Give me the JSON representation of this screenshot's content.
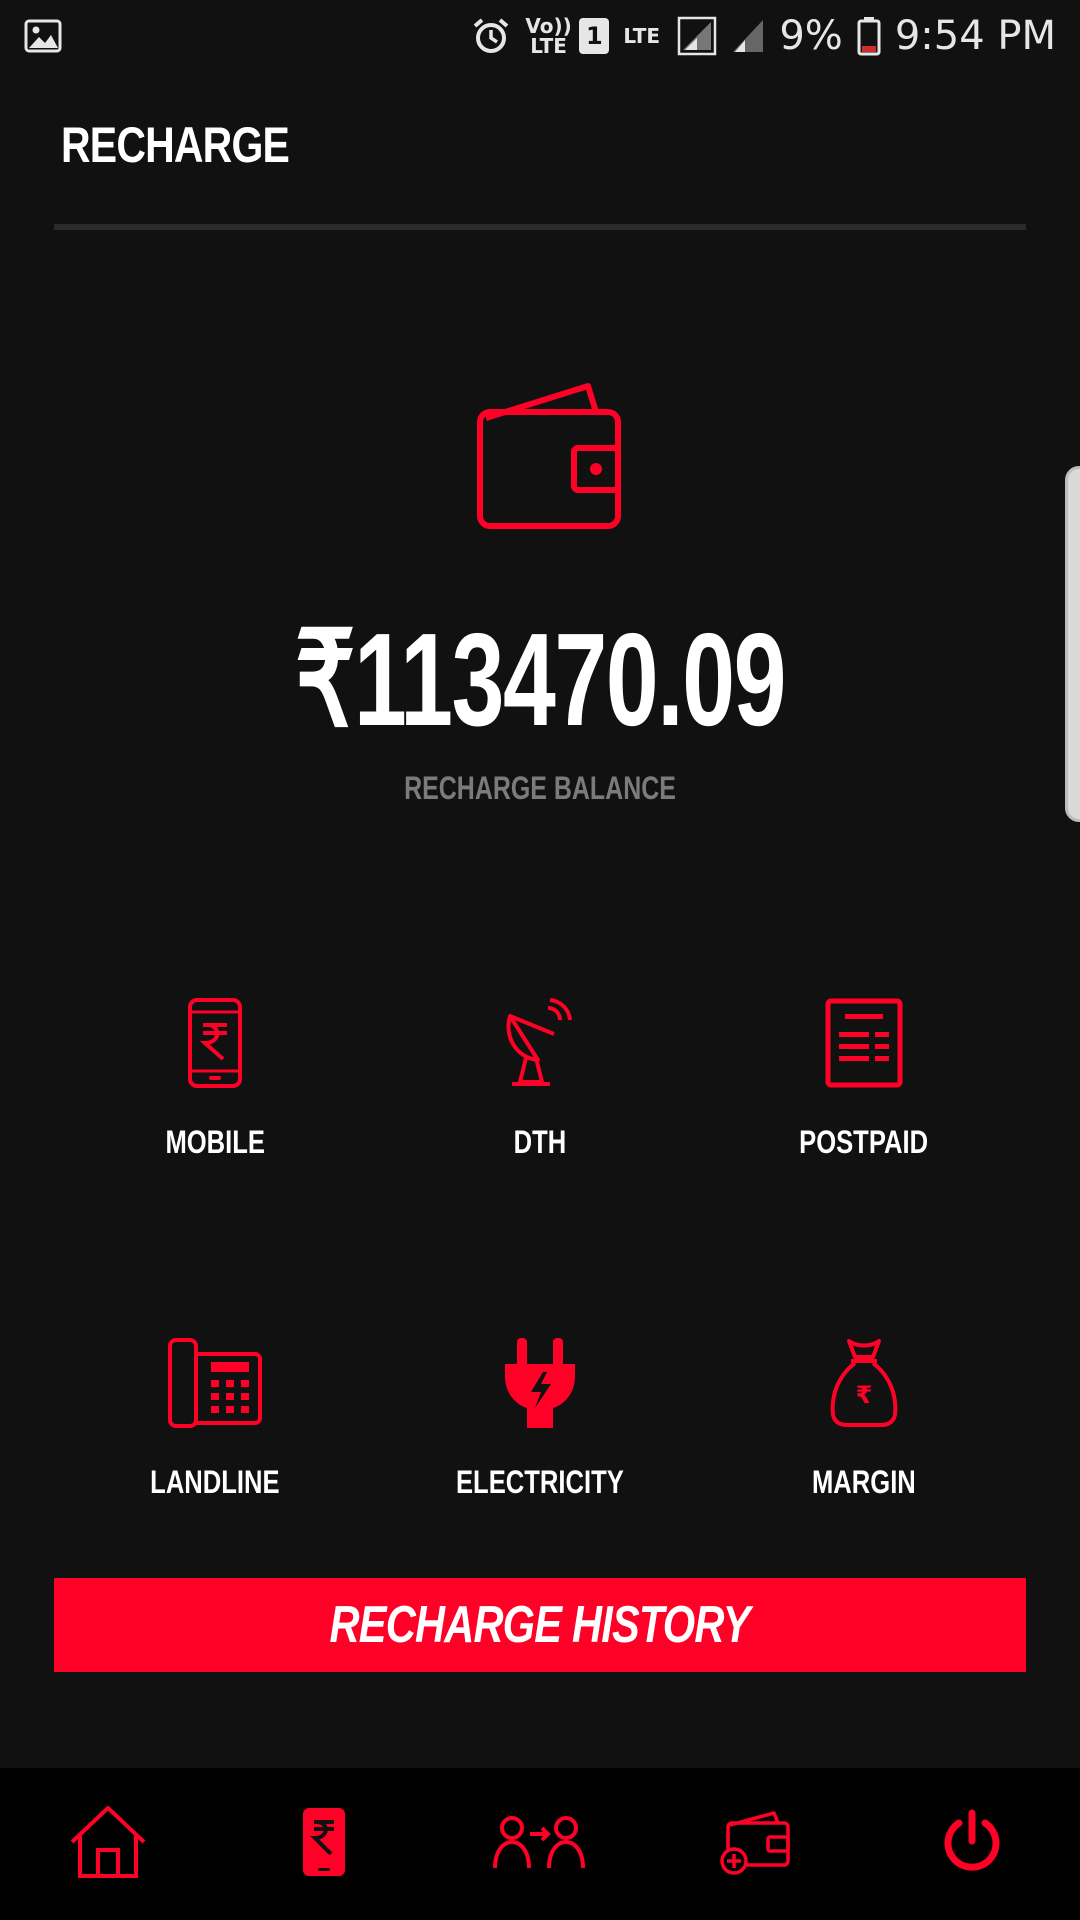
{
  "status_bar": {
    "volte": "Vo)) LTE",
    "sim": "1",
    "lte": "LTE",
    "battery_percent": "9%",
    "time": "9:54 PM"
  },
  "header": {
    "title": "RECHARGE"
  },
  "balance": {
    "amount": "₹113470.09",
    "label": "RECHARGE BALANCE"
  },
  "services": [
    {
      "label": "MOBILE",
      "icon": "mobile-recharge-icon"
    },
    {
      "label": "DTH",
      "icon": "satellite-dish-icon"
    },
    {
      "label": "POSTPAID",
      "icon": "bill-document-icon"
    },
    {
      "label": "LANDLINE",
      "icon": "landline-phone-icon"
    },
    {
      "label": "ELECTRICITY",
      "icon": "power-plug-icon"
    },
    {
      "label": "MARGIN",
      "icon": "money-bag-icon"
    }
  ],
  "actions": {
    "history_label": "RECHARGE HISTORY"
  },
  "bottom_nav": [
    {
      "name": "home",
      "icon": "home-icon",
      "active": false
    },
    {
      "name": "recharge",
      "icon": "mobile-rupee-icon",
      "active": true
    },
    {
      "name": "transfer",
      "icon": "user-transfer-icon",
      "active": false
    },
    {
      "name": "add-money",
      "icon": "wallet-add-icon",
      "active": false
    },
    {
      "name": "logout",
      "icon": "power-icon",
      "active": false
    }
  ],
  "colors": {
    "accent": "#ff0026",
    "background": "#111112",
    "nav_background": "#000000",
    "muted_text": "#7b7b7d"
  }
}
